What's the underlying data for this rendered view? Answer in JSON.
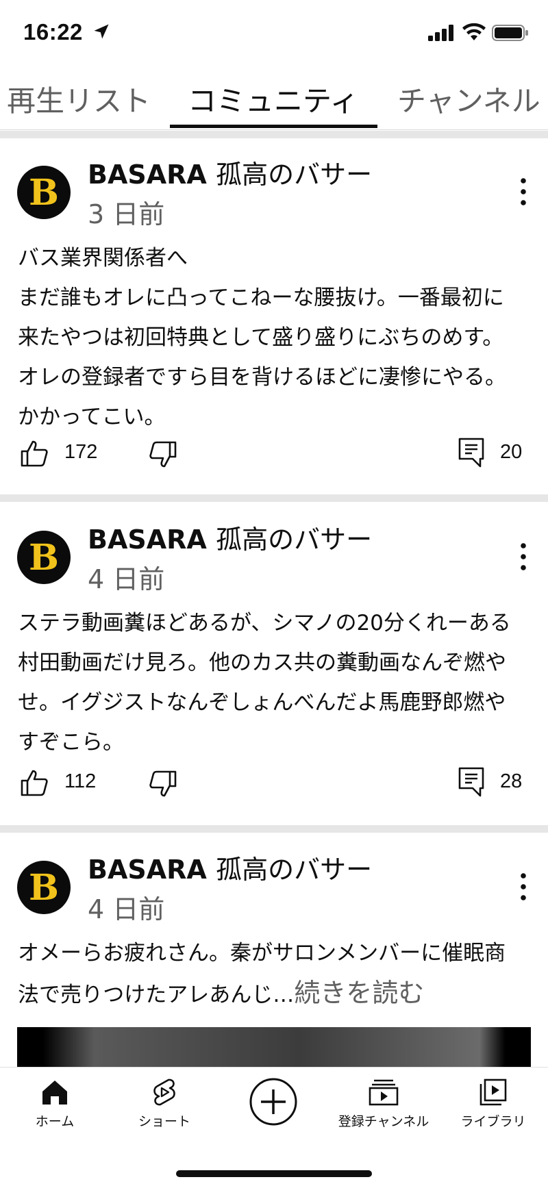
{
  "status_bar": {
    "time": "16:22"
  },
  "tabs": [
    {
      "label": "再生リスト"
    },
    {
      "label": "コミュニティ"
    },
    {
      "label": "チャンネル"
    }
  ],
  "posts": [
    {
      "author_latin": "BASARA",
      "author_jp": "孤高のバサー",
      "avatar_letter": "B",
      "time": "3 日前",
      "text": "バス業界関係者へ\nまだ誰もオレに凸ってこねーな腰抜け。一番最初に来たやつは初回特典として盛り盛りにぶちのめす。オレの登録者ですら目を背けるほどに凄惨にやる。かかってこい。",
      "likes": "172",
      "comments": "20"
    },
    {
      "author_latin": "BASARA",
      "author_jp": "孤高のバサー",
      "avatar_letter": "B",
      "time": "4 日前",
      "text": "ステラ動画糞ほどあるが、シマノの20分くれーある村田動画だけ見ろ。他のカス共の糞動画なんぞ燃やせ。イグジストなんぞしょんべんだよ馬鹿野郎燃やすぞこら。",
      "likes": "112",
      "comments": "28"
    },
    {
      "author_latin": "BASARA",
      "author_jp": "孤高のバサー",
      "avatar_letter": "B",
      "time": "4 日前",
      "text": "オメーらお疲れさん。秦がサロンメンバーに催眠商法で売りつけたアレあんじ…",
      "read_more": "続きを読む"
    }
  ],
  "bottom_nav": {
    "home": "ホーム",
    "shorts": "ショート",
    "subscriptions": "登録チャンネル",
    "library": "ライブラリ"
  },
  "colors": {
    "text": "#0f0f0f",
    "secondary": "#606060",
    "avatar_bg": "#0b0b0b",
    "avatar_letter": "#f1c21b"
  }
}
